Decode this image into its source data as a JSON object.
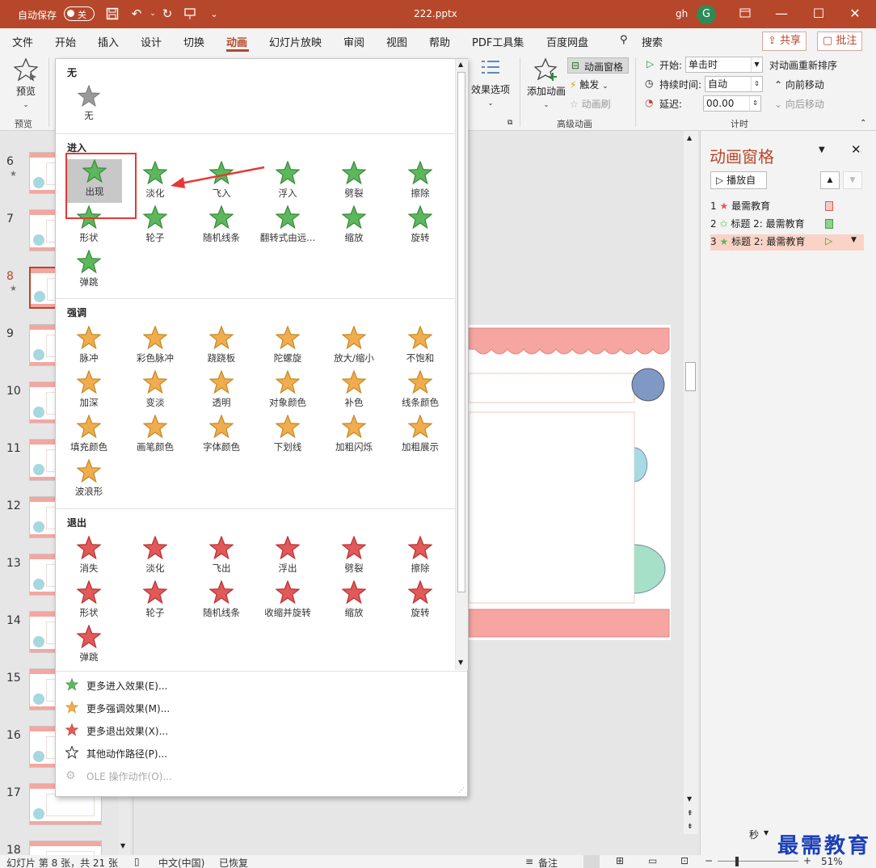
{
  "titlebar": {
    "autosave_label": "自动保存",
    "autosave_state": "关",
    "filename": "222.pptx",
    "user": "gh",
    "avatar_letter": "G"
  },
  "menu": {
    "items": [
      "文件",
      "开始",
      "插入",
      "设计",
      "切换",
      "动画",
      "幻灯片放映",
      "审阅",
      "视图",
      "帮助",
      "PDF工具集",
      "百度网盘"
    ],
    "search": "搜索",
    "share": "共享",
    "comment": "批注"
  },
  "ribbon": {
    "preview": "预览",
    "preview_group": "预览",
    "effect_options": "效果选项",
    "add_animation": "添加动画",
    "animation_pane": "动画窗格",
    "trigger": "触发",
    "animation_painter": "动画刷",
    "advanced_group": "高级动画",
    "start_label": "开始:",
    "start_value": "单击时",
    "duration_label": "持续时间:",
    "duration_value": "自动",
    "delay_label": "延迟:",
    "delay_value": "00.00",
    "reorder": "对动画重新排序",
    "move_earlier": "向前移动",
    "move_later": "向后移动",
    "timing_group": "计时"
  },
  "dropdown": {
    "none_header": "无",
    "none_label": "无",
    "entrance_header": "进入",
    "entrance": [
      "出现",
      "淡化",
      "飞入",
      "浮入",
      "劈裂",
      "擦除",
      "形状",
      "轮子",
      "随机线条",
      "翻转式由远...",
      "缩放",
      "旋转",
      "弹跳"
    ],
    "emphasis_header": "强调",
    "emphasis": [
      "脉冲",
      "彩色脉冲",
      "跷跷板",
      "陀螺旋",
      "放大/缩小",
      "不饱和",
      "加深",
      "变淡",
      "透明",
      "对象颜色",
      "补色",
      "线条颜色",
      "填充颜色",
      "画笔颜色",
      "字体颜色",
      "下划线",
      "加粗闪烁",
      "加粗展示",
      "波浪形"
    ],
    "exit_header": "退出",
    "exit": [
      "消失",
      "淡化",
      "飞出",
      "浮出",
      "劈裂",
      "擦除",
      "形状",
      "轮子",
      "随机线条",
      "收缩并旋转",
      "缩放",
      "旋转",
      "弹跳"
    ],
    "more": [
      "更多进入效果(E)...",
      "更多强调效果(M)...",
      "更多退出效果(X)...",
      "其他动作路径(P)...",
      "OLE 操作动作(O)..."
    ]
  },
  "slides": {
    "numbers": [
      "6",
      "7",
      "8",
      "9",
      "10",
      "11",
      "12",
      "13",
      "14",
      "15",
      "16",
      "17",
      "18"
    ],
    "active": "8"
  },
  "animation_pane": {
    "title": "动画窗格",
    "play_button": "播放自",
    "items": [
      {
        "num": "1",
        "label": "最需教育"
      },
      {
        "num": "2",
        "label": "标题 2: 最需教育"
      },
      {
        "num": "3",
        "label": "标题 2: 最需教育"
      }
    ]
  },
  "statusbar": {
    "slide_info": "幻灯片 第 8 张，共 21 张",
    "language": "中文(中国)",
    "recovered": "已恢复",
    "notes": "备注",
    "zoom": "51%",
    "seconds": "秒"
  },
  "watermark": "最需教育",
  "colors": {
    "accent": "#b7472a",
    "entrance": "#5cb85c",
    "emphasis": "#f0ad4e",
    "exit": "#e05a5a",
    "selection": "#e53935"
  }
}
